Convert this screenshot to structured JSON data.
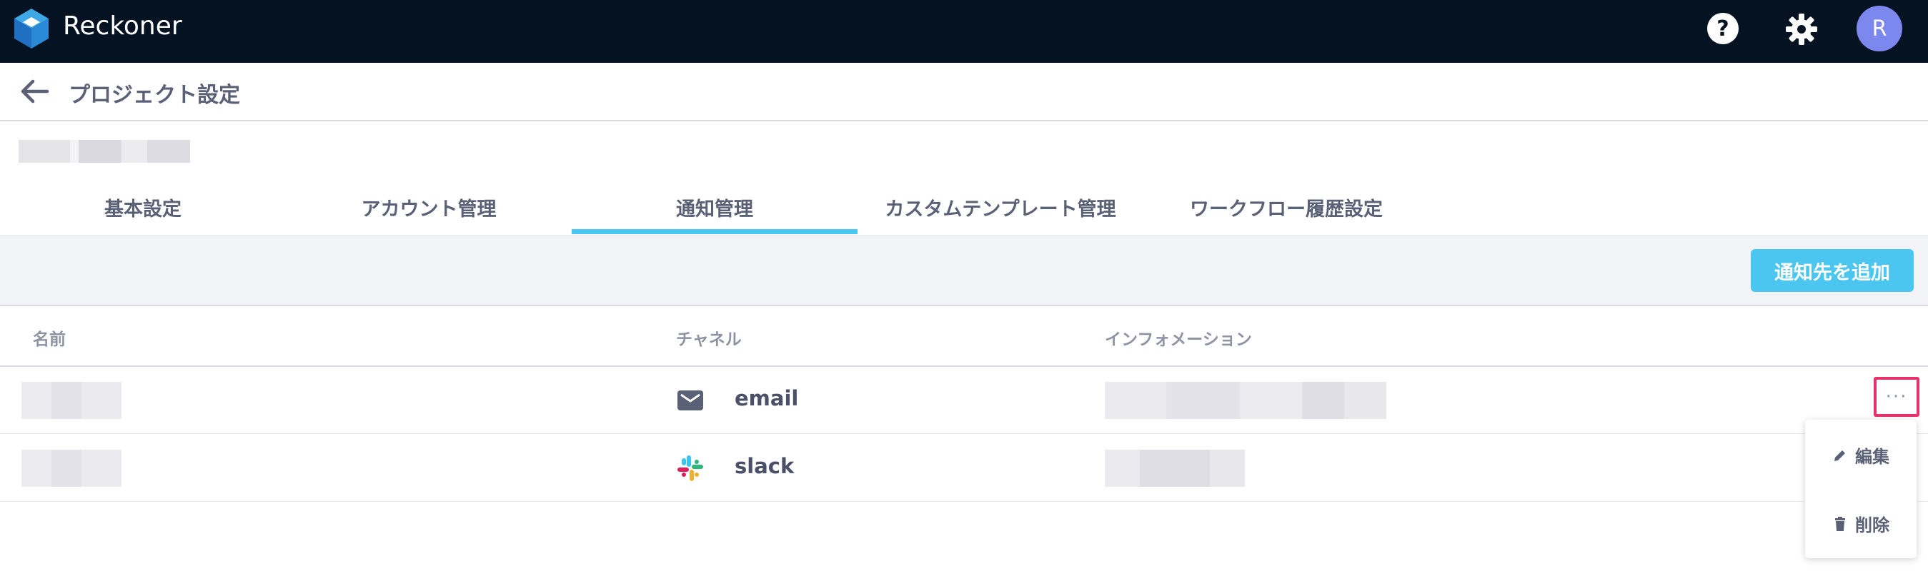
{
  "app": {
    "brand": "Reckoner",
    "avatar_initial": "R",
    "help_glyph": "?"
  },
  "page": {
    "title": "プロジェクト設定"
  },
  "tabs": [
    {
      "label": "基本設定"
    },
    {
      "label": "アカウント管理"
    },
    {
      "label": "通知管理",
      "active": true
    },
    {
      "label": "カスタムテンプレート管理"
    },
    {
      "label": "ワークフロー履歴設定"
    }
  ],
  "toolbar": {
    "add_label": "通知先を追加"
  },
  "table": {
    "headers": {
      "name": "名前",
      "channel": "チャネル",
      "info": "インフォメーション"
    },
    "rows": [
      {
        "channel": "email",
        "channel_icon": "mail-icon"
      },
      {
        "channel": "slack",
        "channel_icon": "slack-icon"
      }
    ]
  },
  "row_menu": {
    "more_glyph": "···",
    "edit_label": "編集",
    "delete_label": "削除"
  },
  "colors": {
    "topbar": "#051222",
    "accent": "#4bc6f0",
    "avatar": "#7d88ef",
    "highlight": "#e8326e"
  }
}
